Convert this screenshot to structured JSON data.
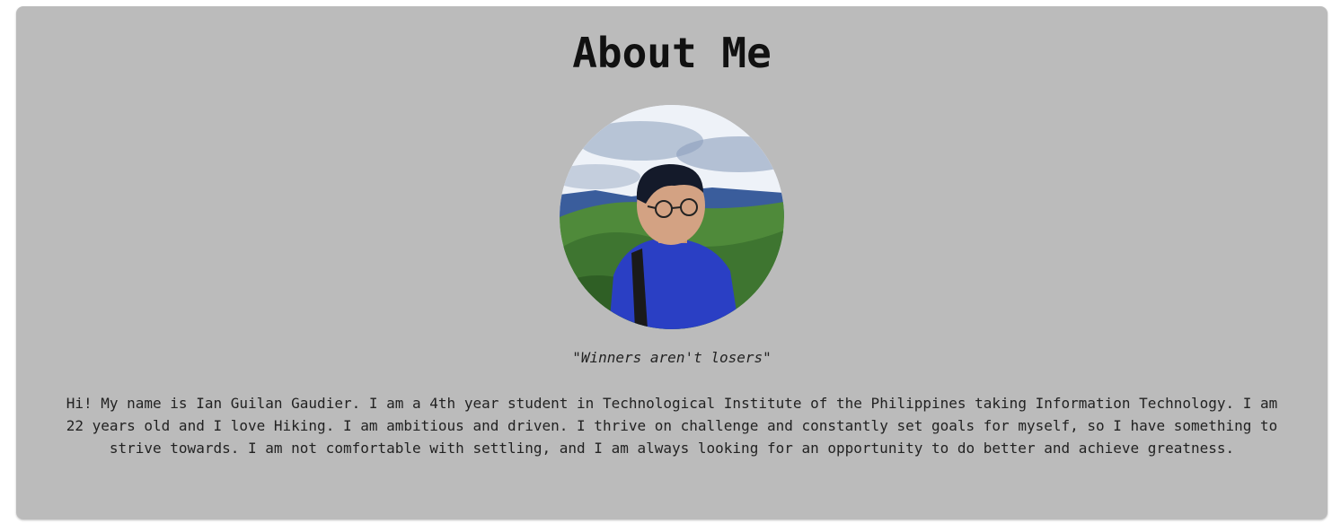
{
  "about": {
    "title": "About Me",
    "quote": "\"Winners aren't losers\"",
    "bio": "Hi! My name is Ian Guilan Gaudier. I am a 4th year student in Technological Institute of the Philippines taking Information Technology. I am 22 years old and I love Hiking. I am ambitious and driven. I thrive on challenge and constantly set goals for myself, so I have something to strive towards. I am not comfortable with settling, and I am always looking for an opportunity to do better and achieve greatness."
  },
  "colors": {
    "card_background": "#bbbbbb",
    "title_text": "#111111",
    "body_text": "#222222"
  }
}
